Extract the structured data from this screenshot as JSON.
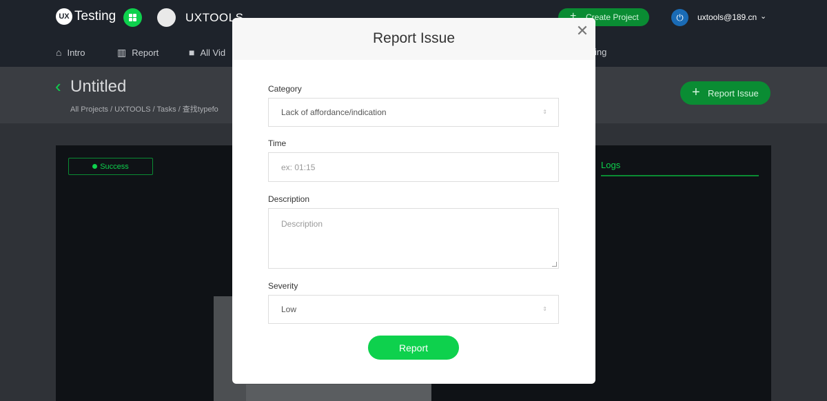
{
  "app": {
    "brand": "Testing",
    "brand_badge": "UX",
    "org_name": "UXTOOLS",
    "create_project": "Create Project",
    "user_email": "uxtools@189.cn"
  },
  "nav": {
    "items": [
      {
        "label": "Intro",
        "icon": "home-icon"
      },
      {
        "label": "Report",
        "icon": "bar-chart-icon"
      },
      {
        "label": "All Vid",
        "icon": "video-icon"
      },
      {
        "label": "ing",
        "icon": ""
      }
    ]
  },
  "page": {
    "title": "Untitled",
    "breadcrumb": "All Projects  /  UXTOOLS  /  Tasks  /  查找typefo",
    "report_issue_button": "Report Issue",
    "status": "Success",
    "logs_tab": "Logs"
  },
  "modal": {
    "title": "Report Issue",
    "close_icon": "close-icon",
    "category": {
      "label": "Category",
      "value": "Lack of affordance/indication"
    },
    "time": {
      "label": "Time",
      "placeholder": "ex: 01:15"
    },
    "description": {
      "label": "Description",
      "placeholder": "Description"
    },
    "severity": {
      "label": "Severity",
      "value": "Low"
    },
    "submit": "Report"
  },
  "colors": {
    "accent": "#0ed14d",
    "accent_dark": "#0a8c33",
    "topbar": "#1e232b"
  }
}
